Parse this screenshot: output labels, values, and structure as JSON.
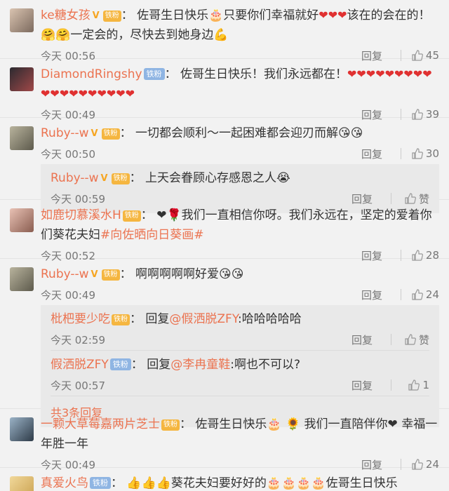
{
  "comments": [
    {
      "user": "ke糖女孩",
      "vip": true,
      "level": "铁粉",
      "text": "佐哥生日快乐🎂只要你们幸福就好",
      "hearts": "❤❤❤",
      "text2": "该在的会在的！🤗🤗一定会的，尽快去到她身边💪",
      "time": "今天 00:56",
      "reply": "回复",
      "likes": "45"
    },
    {
      "user": "DiamondRingshy",
      "fan": "铁粉",
      "text": "佐哥生日快乐！我们永远都在！",
      "hearts": "❤❤❤❤❤❤❤❤❤❤❤❤❤❤❤❤❤❤❤",
      "time": "今天 00:49",
      "reply": "回复",
      "likes": "39"
    },
    {
      "user": "Ruby--w",
      "vip": true,
      "level": "铁粉",
      "text": "一切都会顺利～一起困难都会迎刃而解😘😘",
      "time": "今天 00:50",
      "reply": "回复",
      "likes": "30",
      "subs": [
        {
          "user": "Ruby--w",
          "level": "铁粉",
          "text": "上天会眷顾心存感恩之人😭",
          "time": "今天 00:59",
          "reply": "回复",
          "likes": "赞"
        }
      ]
    },
    {
      "user": "如鹿切慕溪水H",
      "level": "铁粉",
      "text": "❤🌹我们一直相信你呀。我们永远在，坚定的爱着你们葵花夫妇",
      "topic": "#向佐晒向日葵画#",
      "time": "今天 00:52",
      "reply": "回复",
      "likes": "28"
    },
    {
      "user": "Ruby--w",
      "vip": true,
      "level": "铁粉",
      "text": "啊啊啊啊啊好爱😘😘",
      "time": "今天 00:49",
      "reply": "回复",
      "likes": "24",
      "subs": [
        {
          "user": "枇杷要少吃",
          "level": "铁粉",
          "prefix": "回复",
          "at": "@假洒脱ZFY",
          "text": ":哈哈哈哈哈",
          "time": "今天 02:59",
          "reply": "回复",
          "likes": "赞"
        },
        {
          "user": "假洒脱ZFY",
          "fan": "铁粉",
          "prefix": "回复",
          "at": "@李冉童鞋",
          "text": ":啊也不可以?",
          "time": "今天 00:57",
          "reply": "回复",
          "likes": "1"
        }
      ],
      "more": "共3条回复"
    },
    {
      "user": "一颗大草莓嘉两片芝士",
      "level": "铁粉",
      "text": "佐哥生日快乐🎂 🌻 我们一直陪伴你❤ 幸福一年胜一年",
      "time": "今天 00:49",
      "reply": "回复",
      "likes": "24"
    },
    {
      "user": "真爱火鸟",
      "fan": "铁粉",
      "text": "👍👍👍葵花夫妇要好好的🎂🎂🎂🎂佐哥生日快乐",
      "time": "",
      "reply": "",
      "likes": ""
    }
  ]
}
